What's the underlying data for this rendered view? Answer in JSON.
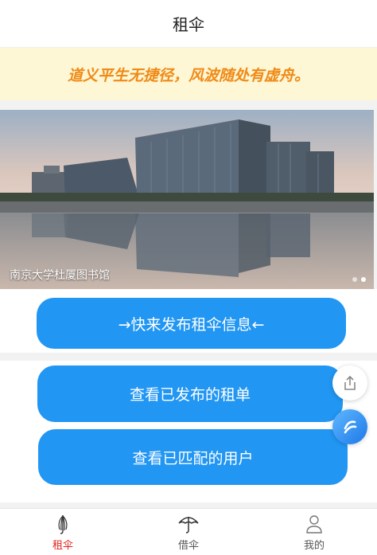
{
  "header": {
    "title": "租伞"
  },
  "motto": {
    "text": "道义平生无捷径，风波随处有虚舟。"
  },
  "banner": {
    "caption": "南京大学杜厦图书馆",
    "slide_count": 2,
    "active_slide": 2
  },
  "actions": {
    "publish_label": "→快来发布租伞信息←",
    "view_published_label": "查看已发布的租单",
    "view_matched_label": "查看已匹配的用户"
  },
  "floating": {
    "share_icon": "share-icon",
    "app_icon": "app-logo-icon"
  },
  "tabbar": {
    "items": [
      {
        "label": "租伞",
        "icon": "umbrella-closed-icon",
        "active": true
      },
      {
        "label": "借伞",
        "icon": "umbrella-open-icon",
        "active": false
      },
      {
        "label": "我的",
        "icon": "user-icon",
        "active": false
      }
    ]
  },
  "colors": {
    "primary": "#2196f3",
    "motto_text": "#f08a17",
    "motto_bg": "#fdf7d5",
    "tab_active": "#e0201b"
  }
}
